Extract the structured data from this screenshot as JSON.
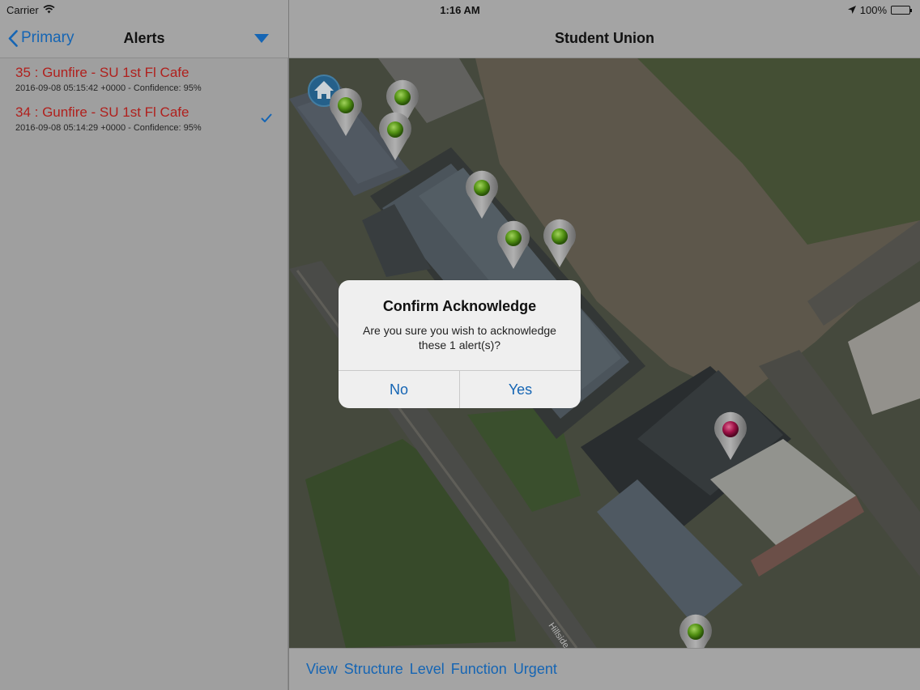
{
  "status_bar": {
    "carrier": "Carrier",
    "time": "1:16 AM",
    "battery": "100%"
  },
  "master": {
    "back_label": "Primary",
    "title": "Alerts",
    "alerts": [
      {
        "title": "35 : Gunfire - SU 1st Fl Cafe",
        "subtitle": "2016-09-08 05:15:42 +0000 - Confidence: 95%",
        "selected": false
      },
      {
        "title": "34 : Gunfire - SU 1st Fl Cafe",
        "subtitle": "2016-09-08 05:14:29 +0000 - Confidence: 95%",
        "selected": true
      }
    ]
  },
  "detail": {
    "title": "Student Union",
    "map": {
      "street_label": "Hillside",
      "markers": [
        "home-marker",
        "green-pin",
        "green-pin",
        "green-pin",
        "green-pin",
        "green-pin",
        "green-pin",
        "red-pin",
        "green-pin"
      ]
    },
    "toolbar": [
      "View",
      "Structure",
      "Level",
      "Function",
      "Urgent"
    ]
  },
  "dialog": {
    "title": "Confirm Acknowledge",
    "message": "Are you sure you wish to acknowledge these 1 alert(s)?",
    "no_label": "No",
    "yes_label": "Yes"
  },
  "colors": {
    "accent": "#1565b4",
    "alert_text": "#b0201d",
    "pin_green": "#6fb81f",
    "pin_red": "#c2185b"
  }
}
